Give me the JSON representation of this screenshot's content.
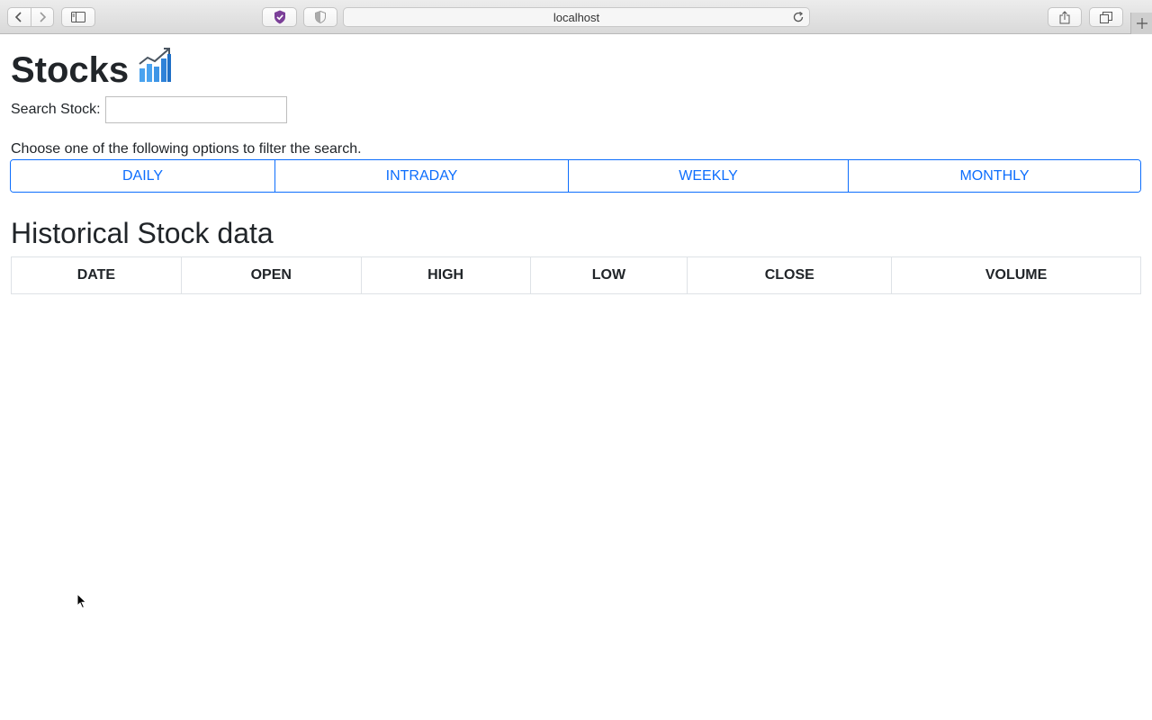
{
  "browser": {
    "url": "localhost"
  },
  "page": {
    "title": "Stocks",
    "title_icon": "chart-increasing-icon",
    "search": {
      "label": "Search Stock:",
      "value": "",
      "placeholder": ""
    },
    "filter_prompt": "Choose one of the following options to filter the search.",
    "filters": [
      "DAILY",
      "INTRADAY",
      "WEEKLY",
      "MONTHLY"
    ],
    "table": {
      "title": "Historical Stock data",
      "columns": [
        "DATE",
        "OPEN",
        "HIGH",
        "LOW",
        "CLOSE",
        "VOLUME"
      ],
      "rows": []
    }
  },
  "colors": {
    "accent": "#0d6efd",
    "text": "#212529",
    "table_border": "#dee2e6"
  }
}
